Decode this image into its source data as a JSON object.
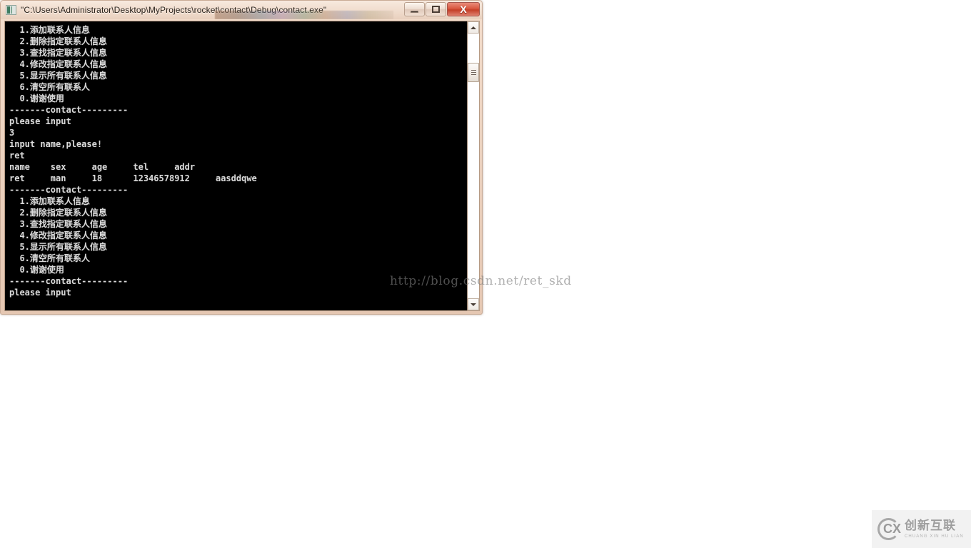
{
  "window": {
    "title": "\"C:\\Users\\Administrator\\Desktop\\MyProjects\\rocket\\contact\\Debug\\contact.exe\"",
    "icon": "console-app-icon",
    "buttons": {
      "minimize": "–",
      "maximize": "□",
      "close": "X"
    }
  },
  "console": {
    "menu_lines": [
      "  1.添加联系人信息",
      "  2.删除指定联系人信息",
      "  3.查找指定联系人信息",
      "  4.修改指定联系人信息",
      "  5.显示所有联系人信息",
      "  6.清空所有联系人",
      "  0.谢谢使用"
    ],
    "separator": "-------contact---------",
    "prompt": "please input",
    "entered_choice": "3",
    "name_prompt": "input name,please!",
    "entered_name": "ret",
    "table_header": "name    sex     age     tel     addr",
    "table_row": "ret     man     18      12346578912     aasddqwe",
    "full_text": "  1.添加联系人信息\n  2.删除指定联系人信息\n  3.查找指定联系人信息\n  4.修改指定联系人信息\n  5.显示所有联系人信息\n  6.清空所有联系人\n  0.谢谢使用\n-------contact---------\nplease input\n3\ninput name,please!\nret\nname    sex     age     tel     addr\nret     man     18      12346578912     aasddqwe\n-------contact---------\n  1.添加联系人信息\n  2.删除指定联系人信息\n  3.查找指定联系人信息\n  4.修改指定联系人信息\n  5.显示所有联系人信息\n  6.清空所有联系人\n  0.谢谢使用\n-------contact---------\nplease input"
  },
  "scrollbar": {
    "up_arrow": "scroll-up-icon",
    "down_arrow": "scroll-down-icon",
    "thumb": "scroll-thumb"
  },
  "watermark": {
    "text": "http://blog.csdn.net/ret_skd"
  },
  "brand": {
    "mark": "CX",
    "name_cn": "创新互联",
    "name_en": "CHUANG XIN HU LIAN"
  },
  "colors": {
    "console_bg": "#000000",
    "console_fg": "#d8d8d8",
    "frame": "#ecd2bf",
    "close_button": "#c43f28",
    "page_bg": "#ffffff"
  }
}
